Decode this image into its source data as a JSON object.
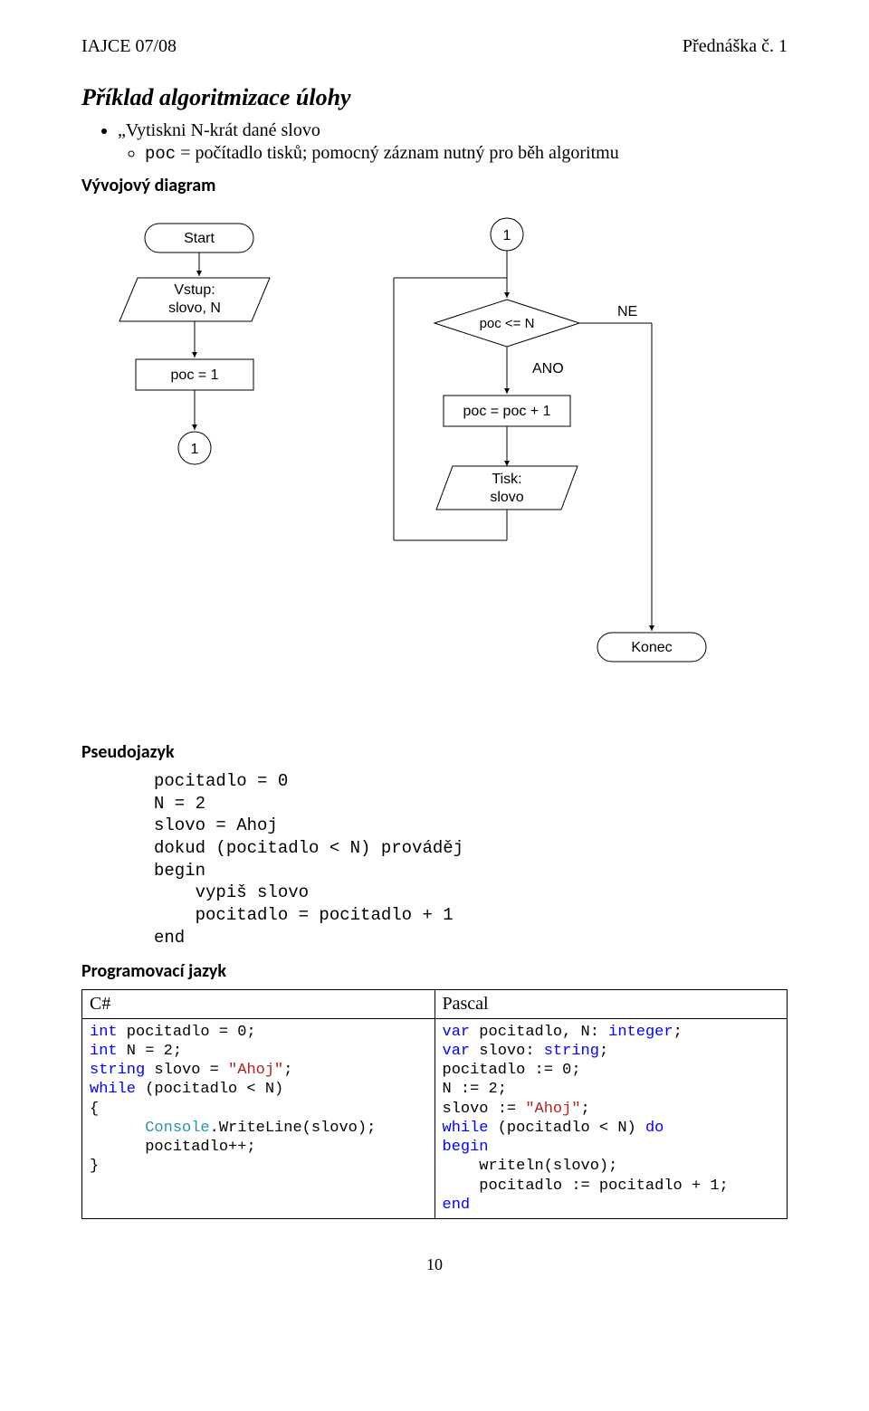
{
  "header": {
    "left": "IAJCE 07/08",
    "right": "Přednáška č. 1"
  },
  "title": "Příklad algoritmizace úlohy",
  "example_line": "„Vytiskni N-krát dané slovo",
  "poc_line_prefix": "poc",
  "poc_line_rest": " = počítadlo tisků; pomocný záznam nutný pro běh algoritmu",
  "vyvojovy_heading": "Vývojový diagram",
  "flow": {
    "start": "Start",
    "vstup_l1": "Vstup:",
    "vstup_l2": "slovo, N",
    "poc_init": "poc = 1",
    "connector": "1",
    "cond": "poc <= N",
    "ne": "NE",
    "ano": "ANO",
    "inc": "poc = poc + 1",
    "tisk_l1": "Tisk:",
    "tisk_l2": "slovo",
    "konec": "Konec"
  },
  "pseudo_heading": "Pseudojazyk",
  "pseudo_lines": "pocitadlo = 0\nN = 2\nslovo = Ahoj\ndokud (pocitadlo < N) prováděj\nbegin\n    vypiš slovo\n    pocitadlo = pocitadlo + 1\nend",
  "prog_heading": "Programovací jazyk",
  "table_head_left": "C#",
  "table_head_right": "Pascal",
  "csharp": {
    "l1a": "int",
    "l1b": " pocitadlo = 0;",
    "l2a": "int",
    "l2b": " N = 2;",
    "l3a": "string",
    "l3b": " slovo = ",
    "l3c": "\"Ahoj\"",
    "l3d": ";",
    "l4a": "while",
    "l4b": " (pocitadlo < N)",
    "l5": "{",
    "l6a": "      ",
    "l6b": "Console",
    "l6c": ".WriteLine(slovo);",
    "l7": "      pocitadlo++;",
    "l8": "}"
  },
  "pascal": {
    "l1a": "var",
    "l1b": " pocitadlo, N: ",
    "l1c": "integer",
    "l1d": ";",
    "l2a": "var",
    "l2b": " slovo: ",
    "l2c": "string",
    "l2d": ";",
    "l3": "pocitadlo := 0;",
    "l4": "N := 2;",
    "l5a": "slovo := ",
    "l5b": "\"Ahoj\"",
    "l5c": ";",
    "l6a": "while",
    "l6b": " (pocitadlo < N) ",
    "l6c": "do",
    "l7a": "begin",
    "l8": "    writeln(slovo);",
    "l9": "    pocitadlo := pocitadlo + 1;",
    "l10a": "end"
  },
  "page_number": "10"
}
